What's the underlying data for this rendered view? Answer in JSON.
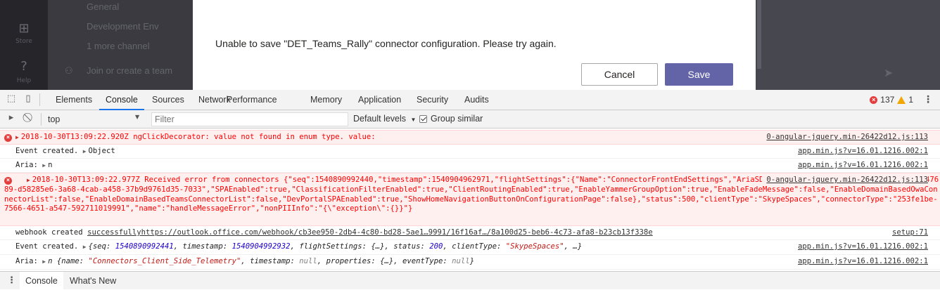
{
  "app": {
    "rail": [
      {
        "icon": "store-icon",
        "label": "Store"
      },
      {
        "icon": "help-icon",
        "label": "Help"
      }
    ],
    "channels": [
      "General",
      "Development Env",
      "1 more channel"
    ],
    "join_team": "Join or create a team"
  },
  "dialog": {
    "message": "Unable to save \"DET_Teams_Rally\" connector configuration. Please try again.",
    "cancel_label": "Cancel",
    "save_label": "Save",
    "save_color": "#6264a7"
  },
  "devtools": {
    "tabs": [
      {
        "label": "Elements",
        "active": false
      },
      {
        "label": "Console",
        "active": true
      },
      {
        "label": "Sources",
        "active": false
      },
      {
        "label": "Network",
        "active": false
      },
      {
        "label": "Performance",
        "active": false
      },
      {
        "label": "Memory",
        "active": false
      },
      {
        "label": "Application",
        "active": false
      },
      {
        "label": "Security",
        "active": false
      },
      {
        "label": "Audits",
        "active": false
      }
    ],
    "error_count": "137",
    "warning_count": "1",
    "context": "top",
    "filter_placeholder": "Filter",
    "levels_label": "Default levels",
    "group_similar_label": "Group similar",
    "group_similar_checked": true
  },
  "console": {
    "messages": [
      {
        "level": "error",
        "text": "2018-10-30T13:09:22.920Z ngClickDecorator: value not found in enum type. value:",
        "source": "0-angular-jquery.min-26422d12.js:113"
      },
      {
        "level": "log",
        "text": "Event created.",
        "object": "Object",
        "source": "app.min.js?v=16.01.1216.002:1"
      },
      {
        "level": "log",
        "text": "Aria:",
        "object": "n",
        "source": "app.min.js?v=16.01.1216.002:1"
      },
      {
        "level": "error",
        "text": "2018-10-30T13:09:22.977Z Received error from connectors {\"seq\":1540890992440,\"timestamp\":1540904962971,\"flightSettings\":{\"Name\":\"ConnectorFrontEndSettings\",\"AriaSDKToken\":\"d127f72a3abd41c9b9dd94faca947689-d58285e6-3a68-4cab-a458-37b9d9761d35-7033\",\"SPAEnabled\":true,\"ClassificationFilterEnabled\":true,\"ClientRoutingEnabled\":true,\"EnableYammerGroupOption\":true,\"EnableFadeMessage\":false,\"EnableDomainBasedOwaConnectorList\":false,\"EnableDomainBasedTeamsConnectorList\":false,\"DevPortalSPAEnabled\":true,\"ShowHomeNavigationButtonOnConfigurationPage\":false},\"status\":500,\"clientType\":\"SkypeSpaces\",\"connectorType\":\"253fe1be-7566-4651-a547-592711019991\",\"name\":\"handleMessageError\",\"nonPIIInfo\":\"{\\\"exception\\\":{}}\"}",
        "source": "0-angular-jquery.min-26422d12.js:113"
      },
      {
        "level": "log",
        "text": "webhook created ",
        "link": "successfullyhttps://outlook.office.com/webhook/cb3ee950-2db4-4c80-bd28-5ae1…9991/16f16af…/8a100d25-beb6-4c73-afa8-b23cb13f338e",
        "source": "setup:71"
      },
      {
        "level": "log",
        "text": "Event created.",
        "preview": {
          "seq": "1540890992441",
          "timestamp": "1540904992932",
          "flightSettings": "{…}",
          "status": "200",
          "clientType": "\"SkypeSpaces\"",
          "rest": "…"
        },
        "source": "app.min.js?v=16.01.1216.002:1"
      },
      {
        "level": "log",
        "text": "Aria:",
        "preview": {
          "name": "\"Connectors_Client_Side_Telemetry\"",
          "timestamp": "null",
          "properties": "{…}",
          "eventType": "null"
        },
        "source": "app.min.js?v=16.01.1216.002:1"
      }
    ]
  },
  "drawer": {
    "tabs": [
      {
        "label": "Console",
        "active": true
      },
      {
        "label": "What's New",
        "active": false
      }
    ]
  }
}
